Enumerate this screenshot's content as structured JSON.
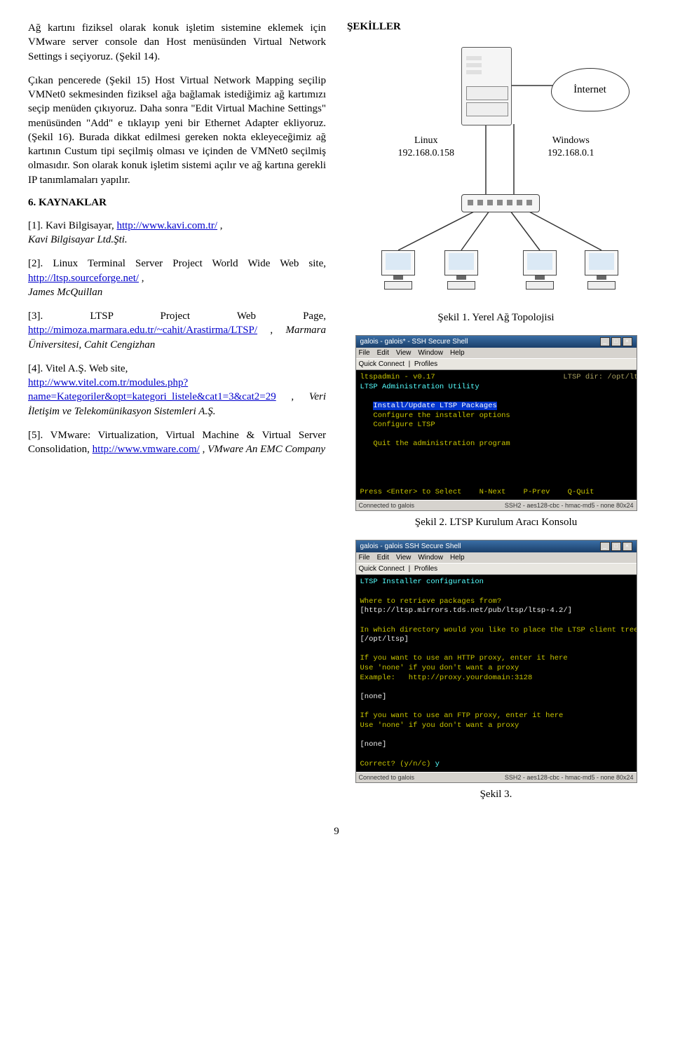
{
  "left": {
    "para1": "Ağ kartını fiziksel olarak konuk işletim sistemine eklemek için VMware server console dan Host menüsünden Virtual Network Settings i seçiyoruz. (Şekil 14).",
    "para2a": "Çıkan pencerede (Şekil 15) Host Virtual Network Mapping seçilip VMNet0 sekmesinden fiziksel ağa bağlamak istediğimiz ağ kartımızı seçip menüden çıkıyoruz. Daha sonra \"Edit Virtual Machine Settings\" menüsünden \"Add\" e tıklayıp yeni bir Ethernet Adapter ekliyoruz. (Şekil 16). Burada dikkat edilmesi gereken nokta ekleyeceğimiz ağ kartının Custum tipi seçilmiş olması ve içinden de VMNet0 seçilmiş olmasıdır. Son olarak konuk işletim sistemi açılır ve ağ kartına gerekli IP tanımlamaları yapılır.",
    "kaynaklar_title": "6. KAYNAKLAR",
    "ref1_pre": "[1]. Kavi Bilgisayar,  ",
    "ref1_link": "http://www.kavi.com.tr/",
    "ref1_post": " ,",
    "ref1_ital": "Kavi Bilgisayar Ltd.Şti.",
    "ref2_pre": "[2]. Linux Terminal Server Project World Wide Web site, ",
    "ref2_link": "http://ltsp.sourceforge.net/",
    "ref2_post": " ,",
    "ref2_ital": "James McQuillan",
    "ref3_pre": "[3]. LTSP Project Web Page, ",
    "ref3_link": "http://mimoza.marmara.edu.tr/~cahit/Arastirma/LTSP/",
    "ref3_post": " , ",
    "ref3_ital": "Marmara Üniversitesi, Cahit Cengizhan",
    "ref4_pre": "[4]. Vitel A.Ş. Web site,",
    "ref4_link": "http://www.vitel.com.tr/modules.php?name=Kategoriler&opt=kategori_listele&cat1=3&cat2=29",
    "ref4_post": ", ",
    "ref4_ital": "Veri İletişim ve Telekomünikasyon Sistemleri A.Ş.",
    "ref5_pre": "[5]. VMware: Virtualization, Virtual Machine & Virtual Server Consolidation, ",
    "ref5_link": "http://www.vmware.com/",
    "ref5_post": ", ",
    "ref5_ital": "VMware An EMC Company"
  },
  "right": {
    "sekiller_title": "ŞEKİLLER",
    "topology": {
      "cloud": "İnternet",
      "linux": "Linux\n192.168.0.158",
      "windows": "Windows\n192.168.0.1"
    },
    "caption1": "Şekil 1. Yerel Ağ Topolojisi",
    "caption2": "Şekil 2. LTSP  Kurulum Aracı Konsolu",
    "caption3": "Şekil 3.",
    "ssh": {
      "title1": "galois - galois* - SSH Secure Shell",
      "title2": "galois - galois SSH Secure Shell",
      "menu": [
        "File",
        "Edit",
        "View",
        "Window",
        "Help"
      ],
      "quick": "Quick Connect",
      "profiles": "Profiles",
      "top_banner_l": "ltspadmin - v0.17",
      "top_banner_r": "LTSP dir: /opt/ltsp",
      "line1": "LTSP Administration Utility",
      "opt1": "Install/Update LTSP Packages",
      "opt2": "Configure the installer options",
      "opt3": "Configure LTSP",
      "opt4": "Quit the administration program",
      "footer1": "Press <Enter> to Select    N-Next    P-Prev    Q-Quit",
      "status_left": "Connected to galois",
      "status_right": "SSH2 - aes128-cbc - hmac-md5 - none   80x24",
      "cfg_title": "LTSP Installer configuration",
      "cfg_q1": "Where to retrieve packages from?",
      "cfg_a1": "[http://ltsp.mirrors.tds.net/pub/ltsp/ltsp-4.2/]",
      "cfg_q2": "In which directory would you like to place the LTSP client tree?",
      "cfg_a2": "[/opt/ltsp]",
      "cfg_q3": "If you want to use an HTTP proxy, enter it here",
      "cfg_q3b": "Use 'none' if you don't want a proxy",
      "cfg_q3c": "Example:   http://proxy.yourdomain:3128",
      "cfg_none": "[none]",
      "cfg_q4": "If you want to use an FTP proxy, enter it here",
      "cfg_q4b": "Use 'none' if you don't want a proxy",
      "cfg_correct": "Correct? (y/n/c) ",
      "cfg_y": "y"
    }
  },
  "page_number": "9"
}
